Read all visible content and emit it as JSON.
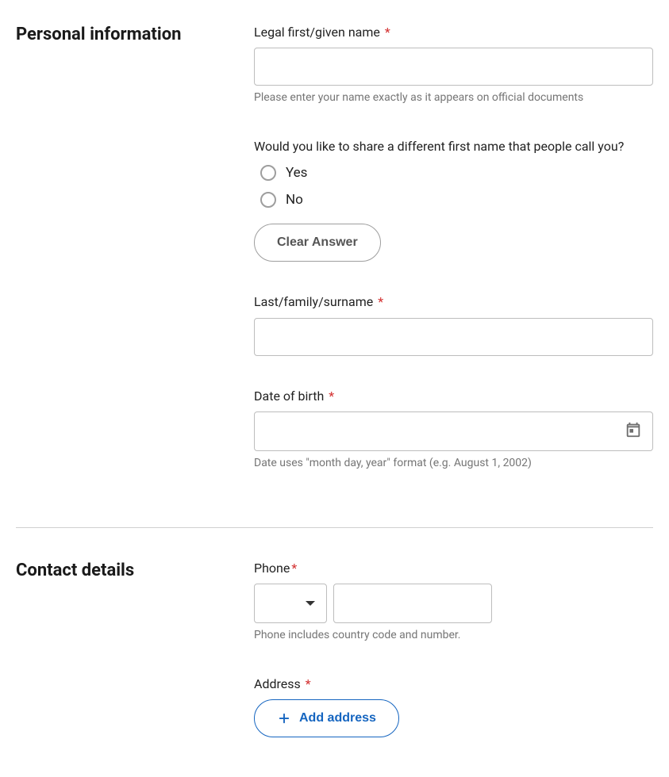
{
  "personal": {
    "section_title": "Personal information",
    "first_name": {
      "label": "Legal first/given name",
      "required": "*",
      "value": "",
      "helper": "Please enter your name exactly as it appears on official documents"
    },
    "preferred_name_question": {
      "label": "Would you like to share a different first name that people call you?",
      "options": {
        "yes": "Yes",
        "no": "No"
      },
      "clear_label": "Clear Answer"
    },
    "last_name": {
      "label": "Last/family/surname",
      "required": "*",
      "value": ""
    },
    "date_of_birth": {
      "label": "Date of birth",
      "required": "*",
      "value": "",
      "helper": "Date uses \"month day, year\" format (e.g. August 1, 2002)"
    }
  },
  "contact": {
    "section_title": "Contact details",
    "phone": {
      "label": "Phone",
      "required": "*",
      "country_value": "",
      "number_value": "",
      "helper": "Phone includes country code and number."
    },
    "address": {
      "label": "Address",
      "required": "*",
      "add_button": "Add address"
    }
  }
}
